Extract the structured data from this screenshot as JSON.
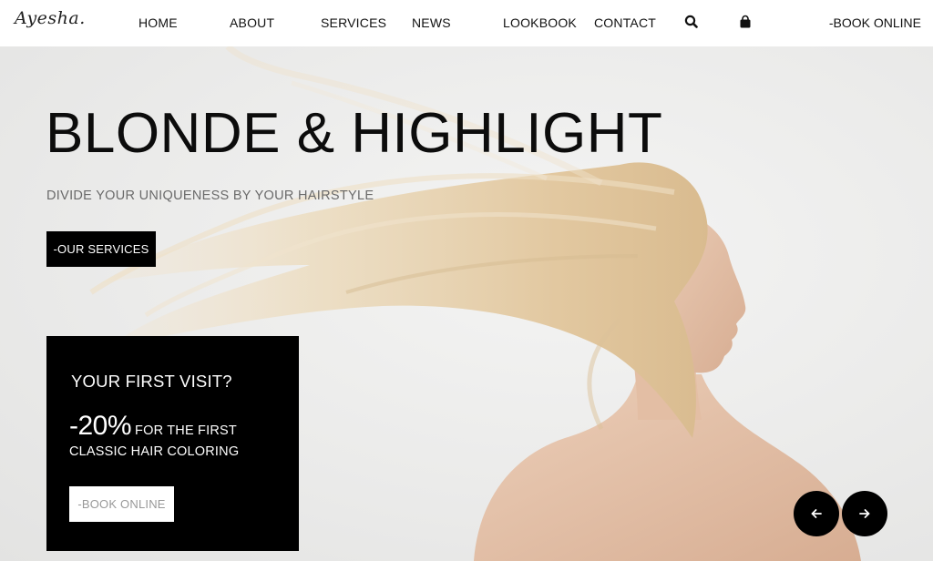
{
  "brand": {
    "logo_text": "Ayesha."
  },
  "nav": {
    "items": [
      {
        "label": "HOME"
      },
      {
        "label": "ABOUT"
      },
      {
        "label": "SERVICES"
      },
      {
        "label": "NEWS"
      },
      {
        "label": "LOOKBOOK"
      },
      {
        "label": "CONTACT"
      }
    ],
    "search_icon": "search-icon",
    "cart_icon": "shopping-bag-icon",
    "book_label": "-BOOK ONLINE"
  },
  "hero": {
    "title": "BLONDE & HIGHLIGHT",
    "subtitle": "DIVIDE YOUR UNIQUENESS BY YOUR HAIRSTYLE",
    "cta_label": "-OUR SERVICES"
  },
  "promo": {
    "heading": "YOUR FIRST VISIT?",
    "discount": "-20%",
    "line1": "FOR THE FIRST",
    "line2": "CLASSIC HAIR COLORING",
    "button_label": "-BOOK ONLINE"
  },
  "slider": {
    "prev_icon": "arrow-left-icon",
    "next_icon": "arrow-right-icon"
  },
  "colors": {
    "background": "#ffffff",
    "hero_bg": "#ebebea",
    "accent": "#000000",
    "hair": "#e6d0ab",
    "skin": "#e8c6ae"
  }
}
